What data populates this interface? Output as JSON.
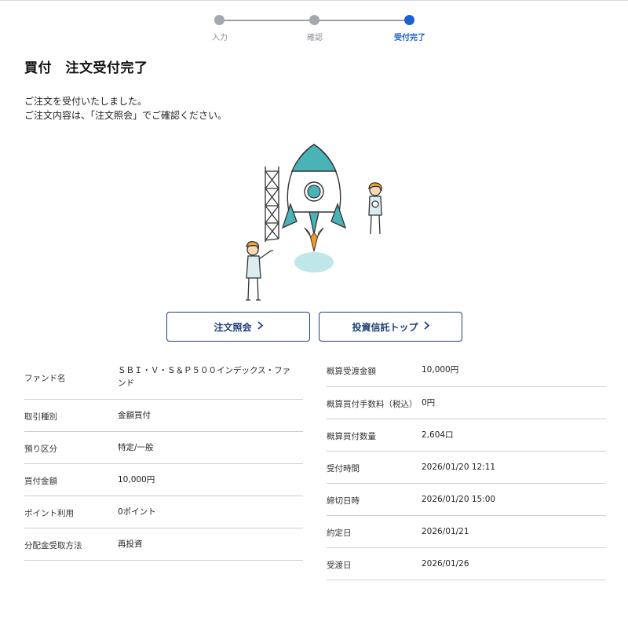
{
  "stepper": {
    "steps": [
      {
        "label": "入力",
        "active": false
      },
      {
        "label": "確認",
        "active": false
      },
      {
        "label": "受付完了",
        "active": true
      }
    ]
  },
  "page_title": "買付　注文受付完了",
  "messages": [
    "ご注文を受付いたしました。",
    "ご注文内容は、「注文照会」でご確認ください。"
  ],
  "buttons": {
    "order_inquiry": "注文照会",
    "fund_top": "投資信託トップ",
    "chevron": "＞"
  },
  "left_details": [
    {
      "label": "ファンド名",
      "value": "ＳＢＩ・Ｖ・Ｓ＆Ｐ５００インデックス・ファンド"
    },
    {
      "label": "取引種別",
      "value": "金額買付"
    },
    {
      "label": "預り区分",
      "value": "特定/一般"
    },
    {
      "label": "買付金額",
      "value": "10,000円"
    },
    {
      "label": "ポイント利用",
      "value": "0ポイント"
    },
    {
      "label": "分配金受取方法",
      "value": "再投資"
    }
  ],
  "right_details": [
    {
      "label": "概算受渡金額",
      "value": "10,000円"
    },
    {
      "label": "概算買付手数料（税込）",
      "value": "0円"
    },
    {
      "label": "概算買付数量",
      "value": "2,604口"
    },
    {
      "label": "受付時間",
      "value": "2026/01/20 12:11"
    },
    {
      "label": "締切日時",
      "value": "2026/01/20 15:00"
    },
    {
      "label": "約定日",
      "value": "2026/01/21"
    },
    {
      "label": "受渡日",
      "value": "2026/01/26"
    }
  ],
  "colors": {
    "accent": "#1a5fd6",
    "button_border": "#1e3f7a",
    "rocket_teal": "#4ab3b8",
    "flame_orange": "#f39a2b"
  }
}
